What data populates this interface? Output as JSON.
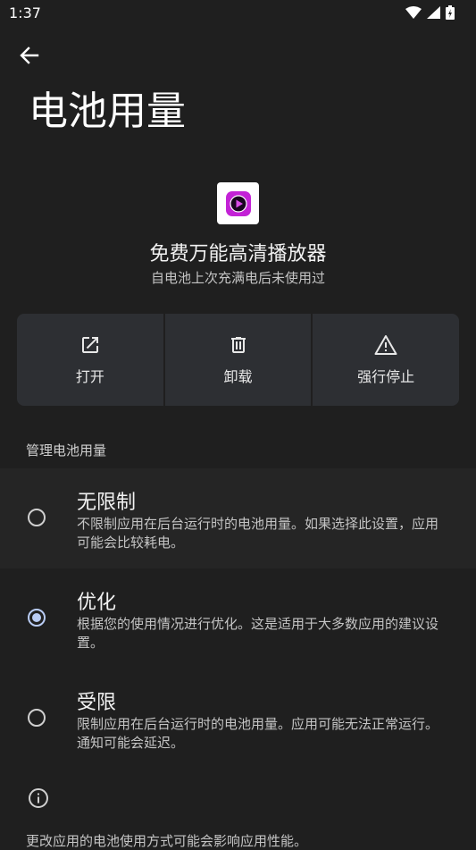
{
  "status_bar": {
    "time": "1:37",
    "icons": [
      "wifi-icon",
      "signal-icon",
      "battery-icon"
    ]
  },
  "header": {
    "back_icon": "arrow-left-icon",
    "title": "电池用量"
  },
  "app": {
    "icon": "video-player-app-icon",
    "name": "免费万能高清播放器",
    "subtitle": "自电池上次充满电后未使用过"
  },
  "actions": [
    {
      "label": "打开",
      "icon": "open-external-icon"
    },
    {
      "label": "卸载",
      "icon": "trash-icon"
    },
    {
      "label": "强行停止",
      "icon": "warning-icon"
    }
  ],
  "manage": {
    "section_title": "管理电池用量",
    "options": [
      {
        "title": "无限制",
        "desc": "不限制应用在后台运行时的电池用量。如果选择此设置，应用可能会比较耗电。",
        "selected": false
      },
      {
        "title": "优化",
        "desc": "根据您的使用情况进行优化。这是适用于大多数应用的建议设置。",
        "selected": true
      },
      {
        "title": "受限",
        "desc": "限制应用在后台运行时的电池用量。应用可能无法正常运行。通知可能会延迟。",
        "selected": false
      }
    ]
  },
  "footer": {
    "info_icon": "info-icon",
    "text": "更改应用的电池使用方式可能会影响应用性能。"
  },
  "colors": {
    "background": "#1f1f1f",
    "action_bg": "#2d2f33",
    "accent": "#b9ccf5",
    "app_icon_purple": "#c322d6"
  }
}
